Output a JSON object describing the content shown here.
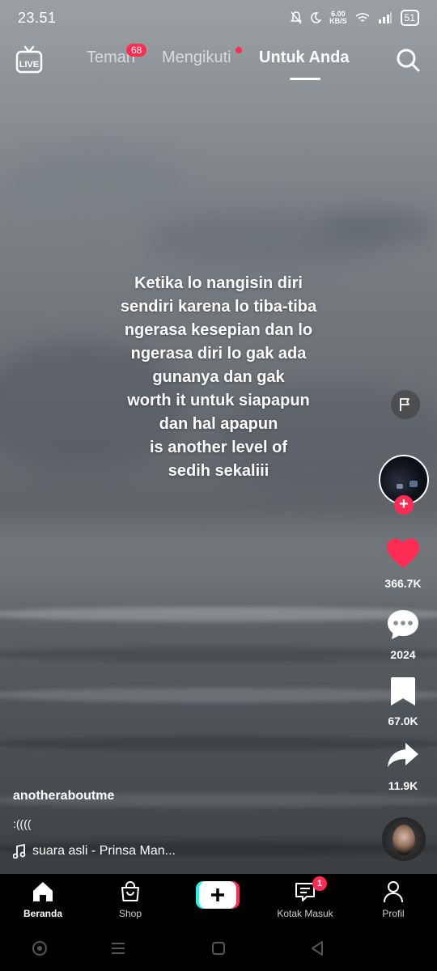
{
  "status_bar": {
    "time": "23.51",
    "net_speed_value": "6.00",
    "net_speed_unit": "KB/S",
    "battery": "51"
  },
  "top_nav": {
    "live_label": "LIVE",
    "tabs": [
      {
        "label": "Teman",
        "badge": "68"
      },
      {
        "label": "Mengikuti"
      },
      {
        "label": "Untuk Anda",
        "active": true
      }
    ]
  },
  "video": {
    "overlay_lines": [
      "Ketika lo nangisin diri",
      "sendiri karena lo tiba-tiba",
      "ngerasa kesepian dan lo",
      "ngerasa diri lo gak ada",
      "gunanya dan gak",
      "worth it untuk siapapun",
      "dan hal apapun",
      "is another level of",
      "sedih sekaliii"
    ],
    "author": "anotheraboutme",
    "description": ":((((",
    "music": "suara asli - Prinsa Man..."
  },
  "actions": {
    "likes": "366.7K",
    "comments": "2024",
    "saves": "67.0K",
    "shares": "11.9K"
  },
  "bottom_nav": {
    "items": [
      {
        "label": "Beranda"
      },
      {
        "label": "Shop"
      },
      {
        "label": "Kotak Masuk",
        "badge": "1"
      },
      {
        "label": "Profil"
      }
    ]
  },
  "colors": {
    "accent": "#fe2c55",
    "text": "#ffffff",
    "nav_bg": "#000000"
  }
}
